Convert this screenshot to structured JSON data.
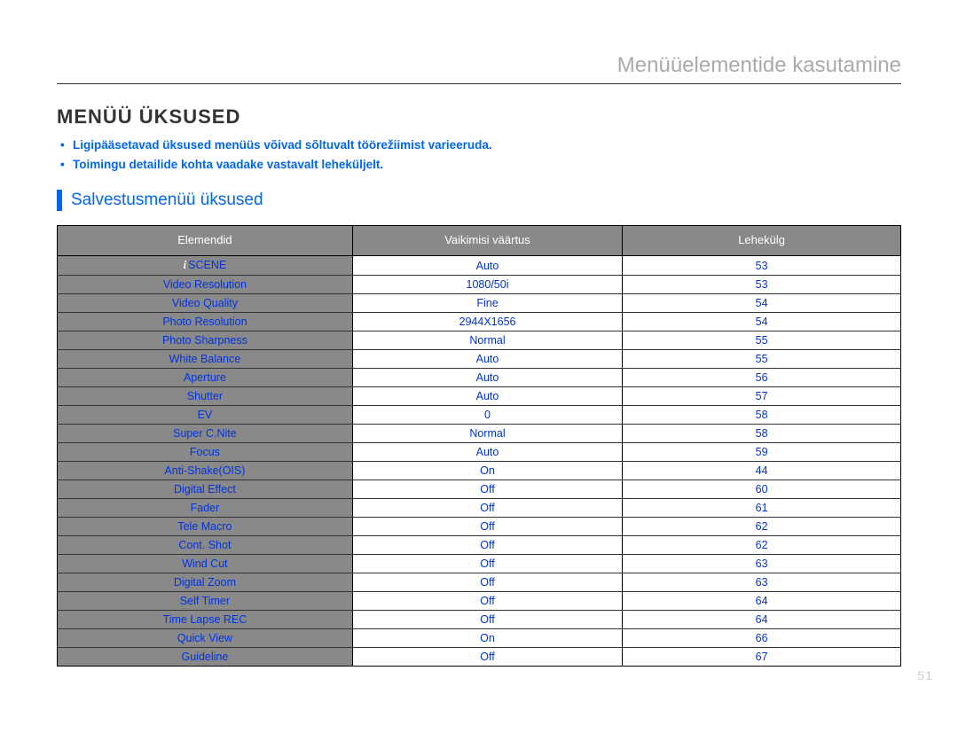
{
  "header": {
    "breadcrumb": "Menüüelementide kasutamine"
  },
  "title": "MENÜÜ ÜKSUSED",
  "bullets": [
    "Ligipääsetavad üksused menüüs võivad sõltuvalt töörežiimist varieeruda.",
    "Toimingu detailide kohta vaadake vastavalt leheküljelt."
  ],
  "section_heading": "Salvestusmenüü üksused",
  "table": {
    "headers": {
      "element": "Elemendid",
      "default": "Vaikimisi väärtus",
      "page": "Lehekülg"
    },
    "rows": [
      {
        "icon": "i",
        "element": "SCENE",
        "default": "Auto",
        "page": "53"
      },
      {
        "element": "Video Resolution",
        "default": "1080/50i",
        "page": "53"
      },
      {
        "element": "Video Quality",
        "default": "Fine",
        "page": "54"
      },
      {
        "element": "Photo Resolution",
        "default": "2944X1656",
        "page": "54"
      },
      {
        "element": "Photo Sharpness",
        "default": "Normal",
        "page": "55"
      },
      {
        "element": "White Balance",
        "default": "Auto",
        "page": "55"
      },
      {
        "element": "Aperture",
        "default": "Auto",
        "page": "56"
      },
      {
        "element": "Shutter",
        "default": "Auto",
        "page": "57"
      },
      {
        "element": "EV",
        "default": "0",
        "page": "58"
      },
      {
        "element": "Super C.Nite",
        "default": "Normal",
        "page": "58"
      },
      {
        "element": "Focus",
        "default": "Auto",
        "page": "59"
      },
      {
        "element": "Anti-Shake(OIS)",
        "default": "On",
        "page": "44"
      },
      {
        "element": "Digital Effect",
        "default": "Off",
        "page": "60"
      },
      {
        "element": "Fader",
        "default": "Off",
        "page": "61"
      },
      {
        "element": "Tele Macro",
        "default": "Off",
        "page": "62"
      },
      {
        "element": "Cont. Shot",
        "default": "Off",
        "page": "62"
      },
      {
        "element": "Wind Cut",
        "default": "Off",
        "page": "63"
      },
      {
        "element": "Digital Zoom",
        "default": "Off",
        "page": "63"
      },
      {
        "element": "Self Timer",
        "default": "Off",
        "page": "64"
      },
      {
        "element": "Time Lapse REC",
        "default": "Off",
        "page": "64"
      },
      {
        "element": "Quick View",
        "default": "On",
        "page": "66"
      },
      {
        "element": "Guideline",
        "default": "Off",
        "page": "67"
      }
    ]
  },
  "page_number": "51"
}
